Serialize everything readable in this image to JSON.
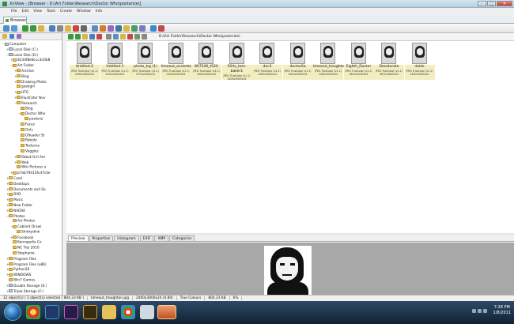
{
  "window": {
    "title": "XnView - [Browser - D:\\Art Folder\\Research\\Doctor Who\\posterize\\]",
    "min": "–",
    "max": "□",
    "close": "✕"
  },
  "menu": [
    "File",
    "Edit",
    "View",
    "Tools",
    "Create",
    "Window",
    "Info"
  ],
  "tab": {
    "label": "Browser"
  },
  "tree": [
    {
      "label": "Computer",
      "indent": 0,
      "kind": "drive",
      "expand": "−"
    },
    {
      "label": "Local Disk (C:)",
      "indent": 1,
      "kind": "drive",
      "expand": "+"
    },
    {
      "label": "Local Disk (D:)",
      "indent": 1,
      "kind": "drive",
      "expand": "−"
    },
    {
      "label": "8234f8e8ccc3d3b8",
      "indent": 2,
      "kind": "folder",
      "expand": "+"
    },
    {
      "label": "Art Folder",
      "indent": 2,
      "kind": "folder",
      "expand": "−"
    },
    {
      "label": "Archive",
      "indent": 3,
      "kind": "folder",
      "expand": "+"
    },
    {
      "label": "Blog",
      "indent": 3,
      "kind": "folder",
      "expand": "+"
    },
    {
      "label": "Drawing Photo",
      "indent": 3,
      "kind": "folder",
      "expand": "+"
    },
    {
      "label": "geekgirl",
      "indent": 3,
      "kind": "folder",
      "expand": ""
    },
    {
      "label": "HTG",
      "indent": 3,
      "kind": "folder",
      "expand": "+"
    },
    {
      "label": "Illustrator Nov",
      "indent": 3,
      "kind": "folder",
      "expand": "+"
    },
    {
      "label": "Research",
      "indent": 3,
      "kind": "folder",
      "expand": "−"
    },
    {
      "label": "Blog",
      "indent": 4,
      "kind": "folder",
      "expand": ""
    },
    {
      "label": "Doctor Who",
      "indent": 4,
      "kind": "folder",
      "expand": "−"
    },
    {
      "label": "posteriz",
      "indent": 5,
      "kind": "folder",
      "expand": ""
    },
    {
      "label": "Faces",
      "indent": 4,
      "kind": "folder",
      "expand": ""
    },
    {
      "label": "Girls",
      "indent": 4,
      "kind": "folder",
      "expand": ""
    },
    {
      "label": "GReader St",
      "indent": 4,
      "kind": "folder",
      "expand": ""
    },
    {
      "label": "Robots",
      "indent": 4,
      "kind": "folder",
      "expand": ""
    },
    {
      "label": "Textures",
      "indent": 4,
      "kind": "folder",
      "expand": ""
    },
    {
      "label": "Veggies",
      "indent": 4,
      "kind": "folder",
      "expand": ""
    },
    {
      "label": "Robot-Girl Am",
      "indent": 3,
      "kind": "folder",
      "expand": "+"
    },
    {
      "label": "Web",
      "indent": 3,
      "kind": "folder",
      "expand": "+"
    },
    {
      "label": "Wiki Pictures o",
      "indent": 3,
      "kind": "folder",
      "expand": ""
    },
    {
      "label": "b7eb79415fcd7c0e",
      "indent": 2,
      "kind": "folder",
      "expand": "+"
    },
    {
      "label": "Corel",
      "indent": 1,
      "kind": "folder",
      "expand": "+"
    },
    {
      "label": "Desktops",
      "indent": 1,
      "kind": "folder",
      "expand": "+"
    },
    {
      "label": "Documents and Se",
      "indent": 1,
      "kind": "folder",
      "expand": "+"
    },
    {
      "label": "DVD",
      "indent": 1,
      "kind": "folder",
      "expand": "+"
    },
    {
      "label": "Music",
      "indent": 1,
      "kind": "folder",
      "expand": "+"
    },
    {
      "label": "New Folder",
      "indent": 1,
      "kind": "folder",
      "expand": "+"
    },
    {
      "label": "NVIDIA",
      "indent": 1,
      "kind": "folder",
      "expand": "+"
    },
    {
      "label": "Photos",
      "indent": 1,
      "kind": "folder",
      "expand": "−"
    },
    {
      "label": "Art Photos",
      "indent": 2,
      "kind": "folder",
      "expand": ""
    },
    {
      "label": "Cabinet Drawi",
      "indent": 2,
      "kind": "folder",
      "expand": "−"
    },
    {
      "label": "Shinkydink",
      "indent": 3,
      "kind": "folder",
      "expand": ""
    },
    {
      "label": "Facebook",
      "indent": 2,
      "kind": "folder",
      "expand": "+"
    },
    {
      "label": "Kennapolis-Co",
      "indent": 2,
      "kind": "folder",
      "expand": ""
    },
    {
      "label": "NC Trip 2010",
      "indent": 2,
      "kind": "folder",
      "expand": ""
    },
    {
      "label": "Stephanie",
      "indent": 2,
      "kind": "folder",
      "expand": ""
    },
    {
      "label": "Program Files",
      "indent": 1,
      "kind": "folder",
      "expand": "+"
    },
    {
      "label": "Program Files (x86)",
      "indent": 1,
      "kind": "folder",
      "expand": "+"
    },
    {
      "label": "Python26",
      "indent": 1,
      "kind": "folder",
      "expand": "+"
    },
    {
      "label": "WINDOWS",
      "indent": 1,
      "kind": "folder",
      "expand": "+"
    },
    {
      "label": "Win7 Games",
      "indent": 1,
      "kind": "folder",
      "expand": ""
    },
    {
      "label": "Double Storage (E:)",
      "indent": 1,
      "kind": "drive",
      "expand": "+"
    },
    {
      "label": "Triple Storage (F:)",
      "indent": 1,
      "kind": "drive",
      "expand": "+"
    }
  ],
  "address": {
    "path": "D:\\Art Folder\\Research\\Doctor Who\\posterize\\"
  },
  "thumbnails": [
    {
      "name": "Untitled-2",
      "type": "JPEG TrueColor (v1.1)",
      "dims": "2400x3000x24"
    },
    {
      "name": "Untitled-1",
      "type": "JPEG TrueColor (v1.1)",
      "dims": "2400x3000x24"
    },
    {
      "name": "photo_trg (1)",
      "type": "JPEG TrueColor (v1.1)",
      "dims": "2370x3000x24"
    },
    {
      "name": "timeout_eccleston",
      "type": "JPEG TrueColor (v1.1)",
      "dims": "2400x3000x24"
    },
    {
      "name": "807346_t520",
      "type": "JPEG TrueColor (v1.1)",
      "dims": "2400x3000x24"
    },
    {
      "name": "504x_tom-baker1",
      "type": "JPEG TrueColor (v1.1)",
      "dims": "2400x3000x24"
    },
    {
      "name": "doc3",
      "type": "JPEG TrueColor (v1.1)",
      "dims": "2400x3000x24"
    },
    {
      "name": "doctor6a",
      "type": "JPEG TrueColor (v1.1)",
      "dims": "2400x3000x24"
    },
    {
      "name": "timeout_troughton",
      "type": "JPEG TrueColor (v1.1)",
      "dims": "2400x3000x24"
    },
    {
      "name": "Eighth_Doctor",
      "type": "JPEG TrueColor (v1.1)",
      "dims": "2400x3000x24"
    },
    {
      "name": "Desaturate",
      "type": "JPEG TrueColor (v1.1)",
      "dims": "4672x5845x24"
    },
    {
      "name": "dalek",
      "type": "JPEG TrueColor (v1.1)",
      "dims": "2400x3000x24"
    }
  ],
  "preview_tabs": [
    "Preview",
    "Properties",
    "Histogram",
    "EXIF",
    "XMP",
    "Categories"
  ],
  "status": {
    "objects": "12 object(s) / 1 object(s) selected  [ 804.23 KB ]",
    "size": "804.23 KB",
    "file": "timeout_troughton.jpg",
    "dims": "2400x3000x24 (0.80)",
    "colors": "True Colours",
    "filesize": "804.23 KB",
    "zoom": "6%"
  },
  "clock": {
    "time": "7:28 PM",
    "date": "1/8/2011"
  },
  "colors": {
    "thumb_label": "#f3eec1",
    "taskbar": "#1b3249"
  }
}
